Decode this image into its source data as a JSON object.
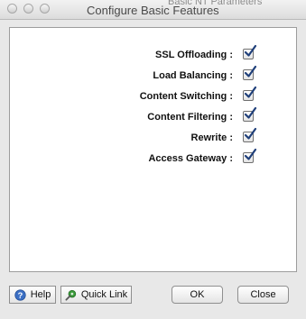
{
  "window": {
    "title": "Configure Basic Features",
    "background_fragment": "Basic NT Parameters"
  },
  "features": [
    {
      "label": "SSL Offloading :",
      "checked": true
    },
    {
      "label": "Load Balancing :",
      "checked": true
    },
    {
      "label": "Content Switching :",
      "checked": true
    },
    {
      "label": "Content Filtering :",
      "checked": true
    },
    {
      "label": "Rewrite :",
      "checked": true
    },
    {
      "label": "Access Gateway :",
      "checked": true
    }
  ],
  "buttons": {
    "help": {
      "label": "Help",
      "icon": "help-icon"
    },
    "quick_link": {
      "label": "Quick Link",
      "icon": "quick-link-icon"
    },
    "ok": {
      "label": "OK"
    },
    "close": {
      "label": "Close"
    }
  },
  "colors": {
    "checkmark": "#1f3f7a",
    "help_icon": "#3b6fc4",
    "quick_link_icon": "#3a9a3a"
  }
}
